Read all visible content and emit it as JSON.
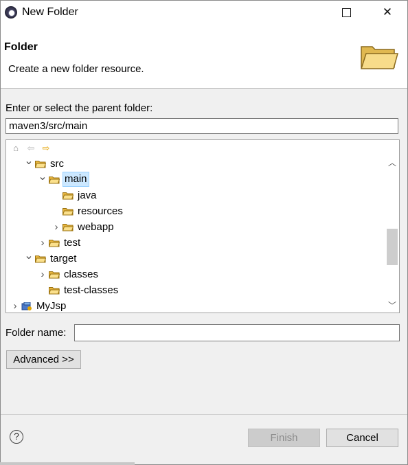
{
  "window": {
    "title": "New Folder",
    "icon": "eclipse-icon"
  },
  "header": {
    "title": "Folder",
    "description": "Create a new folder resource.",
    "icon": "open-folder-icon"
  },
  "parent": {
    "label": "Enter or select the parent folder:",
    "value": "maven3/src/main"
  },
  "tree": {
    "toolbar": [
      "home-icon",
      "back-arrow-icon",
      "forward-arrow-icon"
    ],
    "items": [
      {
        "label": "src",
        "expander": "expanded",
        "type": "folder"
      },
      {
        "label": "main",
        "expander": "expanded",
        "type": "folder",
        "selected": true
      },
      {
        "label": "java",
        "expander": "none",
        "type": "folder"
      },
      {
        "label": "resources",
        "expander": "none",
        "type": "folder"
      },
      {
        "label": "webapp",
        "expander": "collapsed",
        "type": "folder"
      },
      {
        "label": "test",
        "expander": "collapsed",
        "type": "folder"
      },
      {
        "label": "target",
        "expander": "expanded",
        "type": "folder"
      },
      {
        "label": "classes",
        "expander": "collapsed",
        "type": "folder"
      },
      {
        "label": "test-classes",
        "expander": "none",
        "type": "folder"
      },
      {
        "label": "MyJsp",
        "expander": "collapsed",
        "type": "project"
      }
    ]
  },
  "folder_name": {
    "label": "Folder name:",
    "value": ""
  },
  "buttons": {
    "advanced": "Advanced >>",
    "finish": "Finish",
    "cancel": "Cancel"
  },
  "colors": {
    "selection": "#cce8ff",
    "folder": "#f5c242"
  }
}
